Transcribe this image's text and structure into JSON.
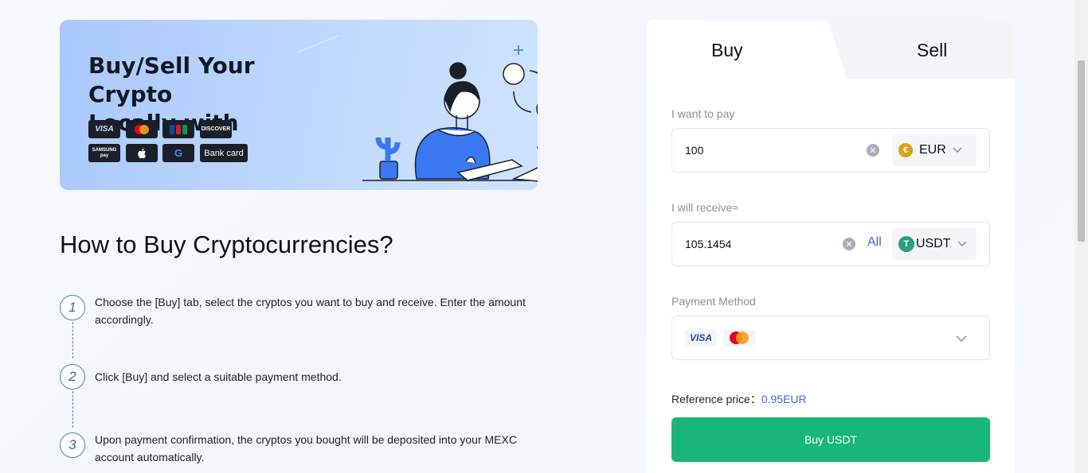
{
  "banner": {
    "title_line1": "Buy/Sell Your Crypto",
    "title_line2": "Locally with",
    "payment_badges": [
      "VISA",
      "",
      "",
      "DISCOVER",
      "SAMSUNG pay",
      "",
      "G",
      "Bank card"
    ]
  },
  "how_to": {
    "title": "How to Buy Cryptocurrencies?",
    "steps": [
      {
        "num": "1",
        "text": "Choose the [Buy] tab, select the cryptos you want to buy and receive. Enter the amount accordingly."
      },
      {
        "num": "2",
        "text": "Click [Buy] and select a suitable payment method."
      },
      {
        "num": "3",
        "text": "Upon payment confirmation, the cryptos you bought will be deposited into your MEXC account automatically."
      }
    ]
  },
  "panel": {
    "tabs": {
      "buy": "Buy",
      "sell": "Sell"
    },
    "pay": {
      "label": "I want to pay",
      "value": "100",
      "currency": "EUR",
      "coin_symbol": "€"
    },
    "receive": {
      "label": "I will receive≈",
      "value": "105.1454",
      "all_label": "All",
      "currency": "USDT",
      "coin_symbol": "T"
    },
    "payment_method": {
      "label": "Payment Method",
      "cards": [
        "VISA",
        "mastercard"
      ]
    },
    "reference_price": {
      "label": "Reference price：",
      "value": "0.95EUR"
    },
    "buy_button": "Buy USDT"
  },
  "colors": {
    "accent": "#19b57a",
    "link": "#3d6bd6",
    "eur_coin": "#d9a21b",
    "usdt_coin": "#26a17b"
  }
}
